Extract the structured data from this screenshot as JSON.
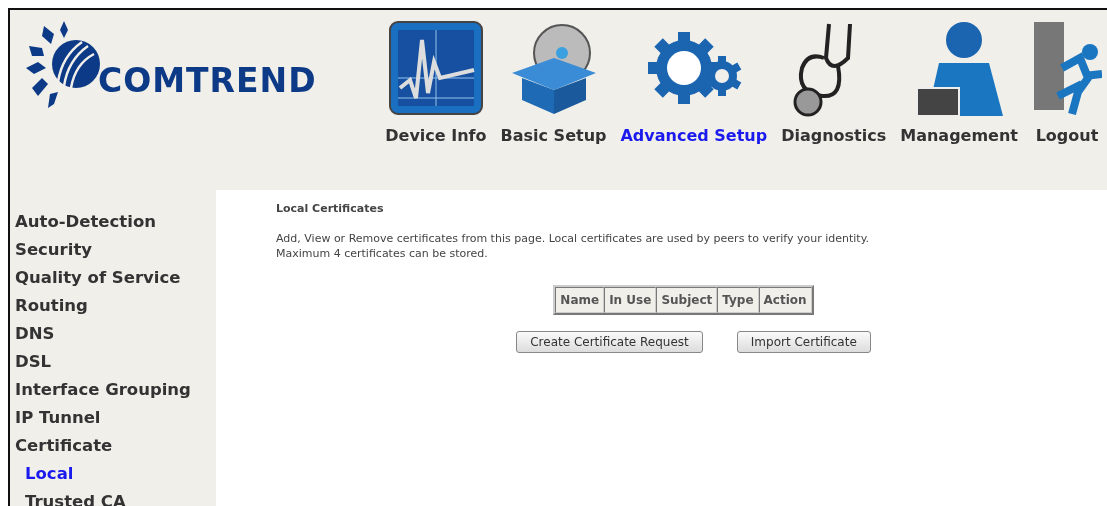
{
  "logo": {
    "text": "COMTREND"
  },
  "nav": [
    {
      "label": "Device Info",
      "kind": "chart",
      "selected": false
    },
    {
      "label": "Basic Setup",
      "kind": "box",
      "selected": false
    },
    {
      "label": "Advanced Setup",
      "kind": "gears",
      "selected": true
    },
    {
      "label": "Diagnostics",
      "kind": "stethoscope",
      "selected": false
    },
    {
      "label": "Management",
      "kind": "person",
      "selected": false
    },
    {
      "label": "Logout",
      "kind": "exit",
      "selected": false
    }
  ],
  "sidebar": {
    "items": [
      {
        "label": "Auto-Detection",
        "selected": false
      },
      {
        "label": "Security",
        "selected": false
      },
      {
        "label": "Quality of Service",
        "selected": false
      },
      {
        "label": "Routing",
        "selected": false
      },
      {
        "label": "DNS",
        "selected": false
      },
      {
        "label": "DSL",
        "selected": false
      },
      {
        "label": "Interface Grouping",
        "selected": false
      },
      {
        "label": "IP Tunnel",
        "selected": false
      },
      {
        "label": "Certificate",
        "selected": false,
        "children": [
          {
            "label": "Local",
            "selected": true
          },
          {
            "label": "Trusted CA",
            "selected": false
          }
        ]
      }
    ]
  },
  "content": {
    "title": "Local Certificates",
    "description": [
      "Add, View or Remove certificates from this page. Local certificates are used by peers to verify your identity.",
      "Maximum 4 certificates can be stored."
    ],
    "table": {
      "columns": [
        "Name",
        "In Use",
        "Subject",
        "Type",
        "Action"
      ]
    },
    "buttons": [
      "Create Certificate Request",
      "Import Certificate"
    ]
  }
}
